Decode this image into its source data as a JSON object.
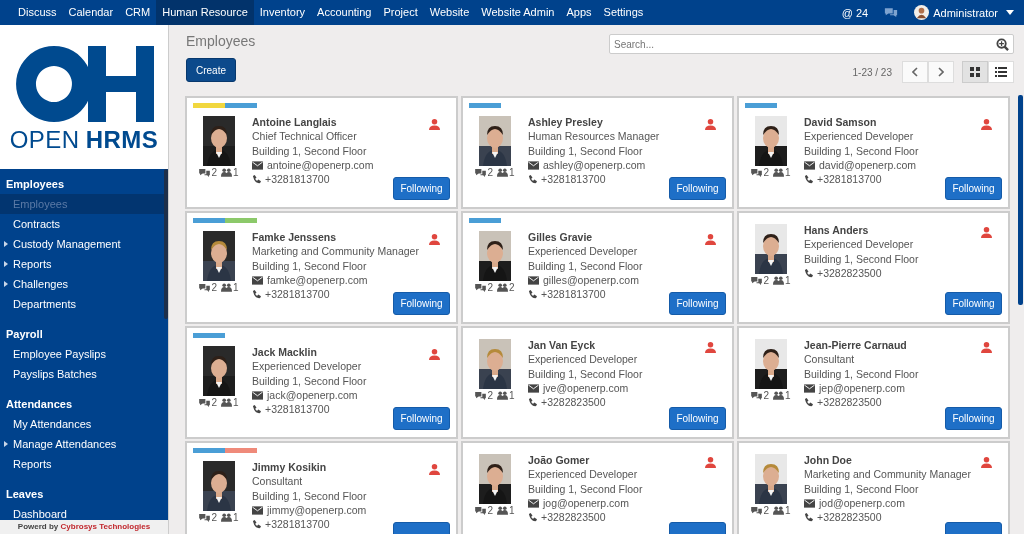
{
  "top_nav": {
    "items": [
      {
        "label": "Discuss",
        "selected": false
      },
      {
        "label": "Calendar",
        "selected": false
      },
      {
        "label": "CRM",
        "selected": false
      },
      {
        "label": "Human Resource",
        "selected": true
      },
      {
        "label": "Inventory",
        "selected": false
      },
      {
        "label": "Accounting",
        "selected": false
      },
      {
        "label": "Project",
        "selected": false
      },
      {
        "label": "Website",
        "selected": false
      },
      {
        "label": "Website Admin",
        "selected": false
      },
      {
        "label": "Apps",
        "selected": false
      },
      {
        "label": "Settings",
        "selected": false
      }
    ],
    "mentions": "@ 24",
    "user": "Administrator"
  },
  "sidebar": {
    "logo": {
      "top": "OPEN",
      "bottom": "HRMS"
    },
    "sections": [
      {
        "title": "Employees",
        "items": [
          {
            "label": "Employees",
            "selected": true,
            "expandable": false
          },
          {
            "label": "Contracts",
            "selected": false,
            "expandable": false
          },
          {
            "label": "Custody Management",
            "selected": false,
            "expandable": true
          },
          {
            "label": "Reports",
            "selected": false,
            "expandable": true
          },
          {
            "label": "Challenges",
            "selected": false,
            "expandable": true
          },
          {
            "label": "Departments",
            "selected": false,
            "expandable": false
          }
        ]
      },
      {
        "title": "Payroll",
        "items": [
          {
            "label": "Employee Payslips",
            "selected": false,
            "expandable": false
          },
          {
            "label": "Payslips Batches",
            "selected": false,
            "expandable": false
          }
        ]
      },
      {
        "title": "Attendances",
        "items": [
          {
            "label": "My Attendances",
            "selected": false,
            "expandable": false
          },
          {
            "label": "Manage Attendances",
            "selected": false,
            "expandable": true
          },
          {
            "label": "Reports",
            "selected": false,
            "expandable": false
          }
        ]
      },
      {
        "title": "Leaves",
        "items": [
          {
            "label": "Dashboard",
            "selected": false,
            "expandable": false
          }
        ]
      }
    ],
    "footer": {
      "text": "Powerd by",
      "company": "Cybrosys Technologies"
    }
  },
  "page": {
    "title": "Employees",
    "create_button": "Create",
    "search": {
      "placeholder": "Search..."
    },
    "pager": "1-23 / 23",
    "views": [
      {
        "kind": "kanban",
        "selected": true
      },
      {
        "kind": "list",
        "selected": false
      }
    ]
  },
  "employees": [
    {
      "name": "Antoine Langlais",
      "job": "Chief Technical Officer",
      "location": "Building 1, Second Floor",
      "email": "antoine@openerp.com",
      "phone": "+3281813700",
      "messages": "2",
      "followers": "1",
      "button": "Following",
      "tags": [
        {
          "color": "#f1d73e"
        },
        {
          "color": "#4a9ed6"
        }
      ]
    },
    {
      "name": "Ashley Presley",
      "job": "Human Resources Manager",
      "location": "Building 1, Second Floor",
      "email": "ashley@openerp.com",
      "phone": "+3281813700",
      "messages": "2",
      "followers": "1",
      "button": "Following",
      "tags": [
        {
          "color": "#4a9ed6"
        }
      ]
    },
    {
      "name": "David Samson",
      "job": "Experienced Developer",
      "location": "Building 1, Second Floor",
      "email": "david@openerp.com",
      "phone": "+3281813700",
      "messages": "2",
      "followers": "1",
      "button": "Following",
      "tags": [
        {
          "color": "#4a9ed6"
        }
      ]
    },
    {
      "name": "Famke Jenssens",
      "job": "Marketing and Community Manager",
      "location": "Building 1, Second Floor",
      "email": "famke@openerp.com",
      "phone": "+3281813700",
      "messages": "2",
      "followers": "1",
      "button": "Following",
      "tags": [
        {
          "color": "#4a9ed6"
        },
        {
          "color": "#8cc96a"
        }
      ]
    },
    {
      "name": "Gilles Gravie",
      "job": "Experienced Developer",
      "location": "Building 1, Second Floor",
      "email": "gilles@openerp.com",
      "phone": "+3281813700",
      "messages": "2",
      "followers": "2",
      "button": "Following",
      "tags": [
        {
          "color": "#4a9ed6"
        }
      ]
    },
    {
      "name": "Hans Anders",
      "job": "Experienced Developer",
      "location": "Building 1, Second Floor",
      "phone": "+3282823500",
      "messages": "2",
      "followers": "1",
      "button": "Following"
    },
    {
      "name": "Jack Macklin",
      "job": "Experienced Developer",
      "location": "Building 1, Second Floor",
      "email": "jack@openerp.com",
      "phone": "+3281813700",
      "messages": "2",
      "followers": "1",
      "button": "Following",
      "tags": [
        {
          "color": "#4a9ed6"
        }
      ]
    },
    {
      "name": "Jan Van Eyck",
      "job": "Experienced Developer",
      "location": "Building 1, Second Floor",
      "email": "jve@openerp.com",
      "phone": "+3282823500",
      "messages": "2",
      "followers": "1",
      "button": "Following"
    },
    {
      "name": "Jean-Pierre Carnaud",
      "job": "Consultant",
      "location": "Building 1, Second Floor",
      "email": "jep@openerp.com",
      "phone": "+3282823500",
      "messages": "2",
      "followers": "1",
      "button": "Following"
    },
    {
      "name": "Jimmy Kosikin",
      "job": "Consultant",
      "location": "Building 1, Second Floor",
      "email": "jimmy@openerp.com",
      "phone": "+3281813700",
      "messages": "2",
      "followers": "1",
      "tags": [
        {
          "color": "#4a9ed6"
        },
        {
          "color": "#ef8a7a"
        }
      ]
    },
    {
      "name": "João Gomer",
      "job": "Experienced Developer",
      "location": "Building 1, Second Floor",
      "email": "jog@openerp.com",
      "phone": "+3282823500",
      "messages": "2",
      "followers": "1"
    },
    {
      "name": "John Doe",
      "job": "Marketing and Community Manager",
      "location": "Building 1, Second Floor",
      "email": "jod@openerp.com",
      "phone": "+3282823500",
      "messages": "2",
      "followers": "1"
    }
  ]
}
